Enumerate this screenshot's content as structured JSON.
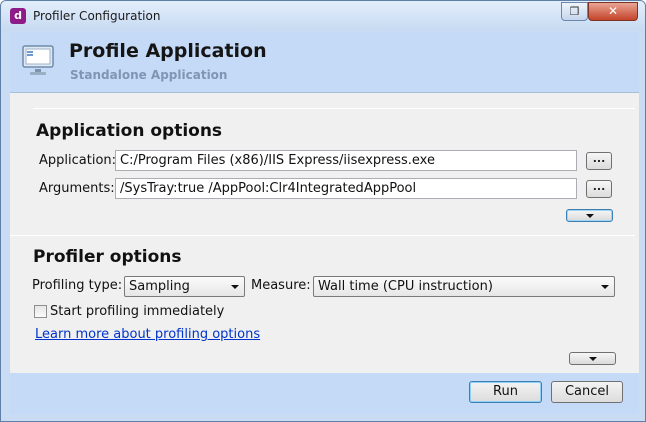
{
  "window": {
    "title": "Profiler Configuration",
    "app_icon_glyph": "d",
    "restore_glyph": "❐",
    "close_glyph": "✕"
  },
  "header": {
    "title": "Profile Application",
    "subtitle": "Standalone Application",
    "icon": "monitor-icon"
  },
  "application_options": {
    "section_title": "Application options",
    "application_label": "Application:",
    "application_value": "C:/Program Files (x86)/IIS Express/iisexpress.exe",
    "arguments_label": "Arguments:",
    "arguments_value": "/SysTray:true /AppPool:Clr4IntegratedAppPool",
    "browse_label": "..."
  },
  "profiler_options": {
    "section_title": "Profiler options",
    "profiling_type_label": "Profiling type:",
    "profiling_type_value": "Sampling",
    "measure_label": "Measure:",
    "measure_value": "Wall time (CPU instruction)",
    "start_immediately_label": "Start profiling immediately",
    "start_immediately_checked": false,
    "learn_more_link": "Learn more about profiling options"
  },
  "footer": {
    "run_label": "Run",
    "cancel_label": "Cancel"
  },
  "colors": {
    "header_bg": "#c5daf6",
    "content_bg": "#f0f0f0",
    "link": "#0033cc",
    "subtitle": "#7e96b3"
  }
}
